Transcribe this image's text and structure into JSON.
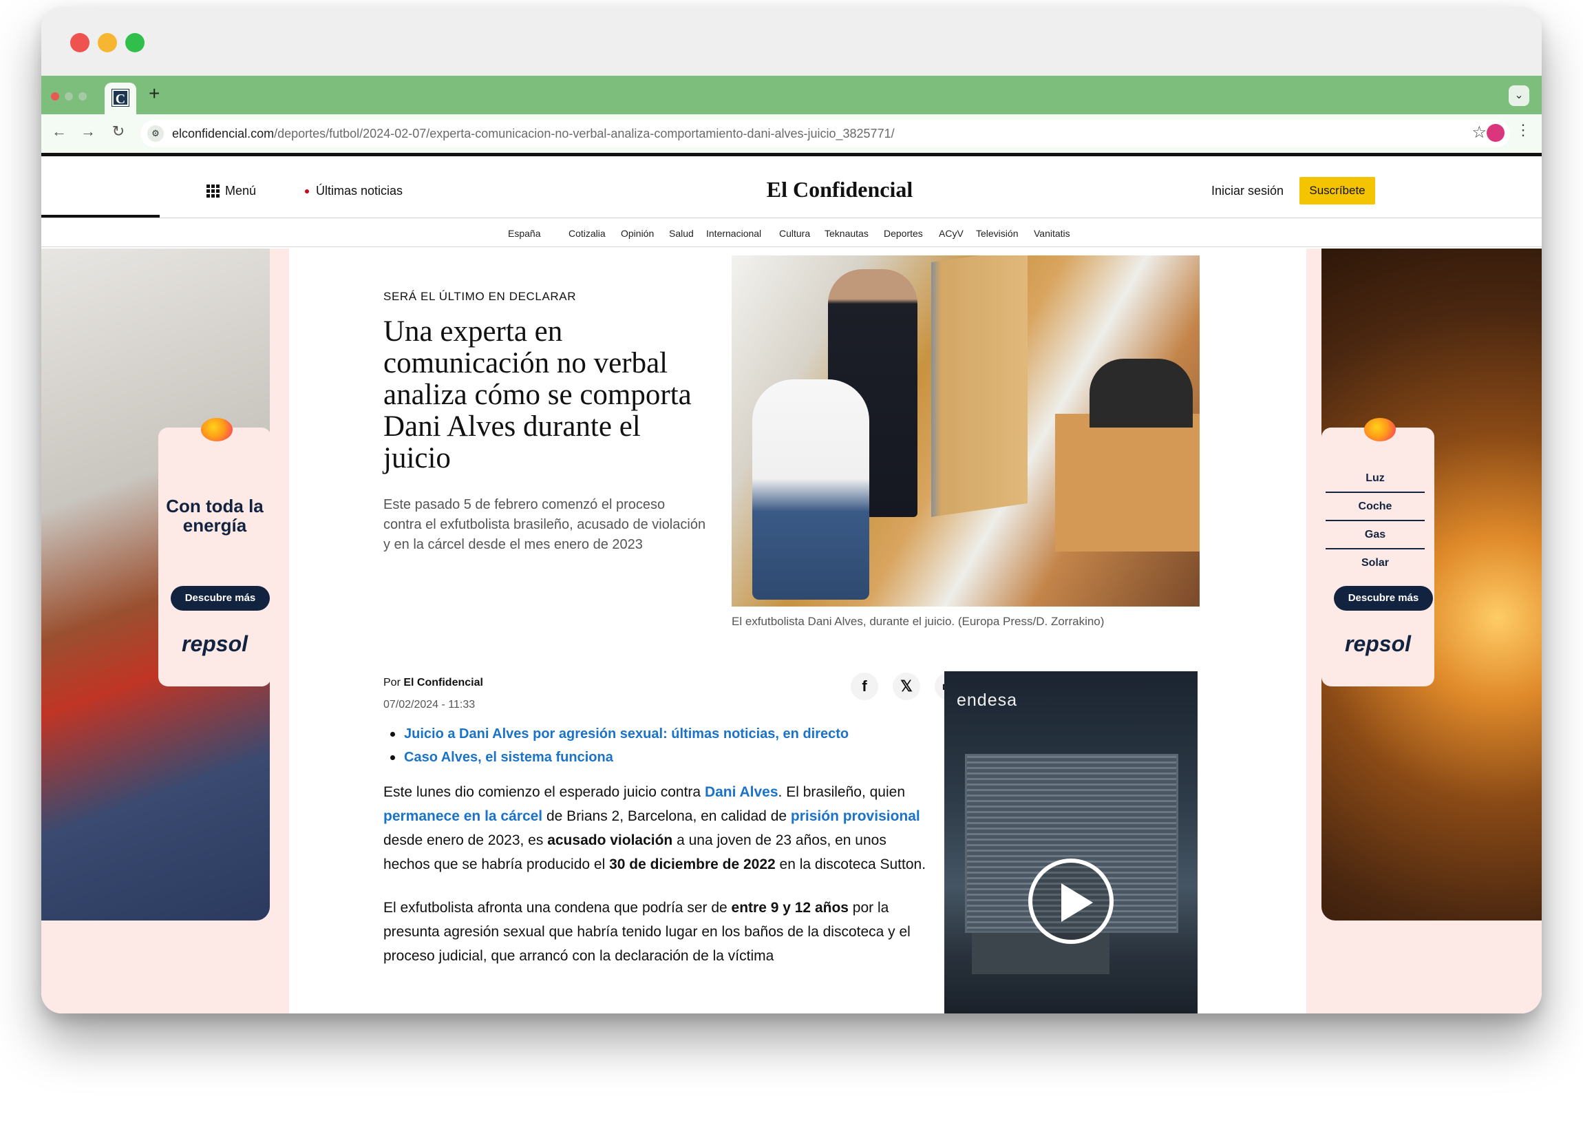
{
  "browser": {
    "new_tab": "+",
    "url_domain": "elconfidencial.com",
    "url_path": "/deportes/futbol/2024-02-07/experta-comunicacion-no-verbal-analiza-comportamiento-dani-alves-juicio_3825771/",
    "favicon_letter": "C"
  },
  "header": {
    "menu_label": "Menú",
    "latest_label": "Últimas noticias",
    "logo": "El Confidencial",
    "login_label": "Iniciar sesión",
    "subscribe_label": "Suscríbete"
  },
  "sections": [
    "España",
    "Cotizalia",
    "Opinión",
    "Salud",
    "Internacional",
    "Cultura",
    "Teknautas",
    "Deportes",
    "ACyV",
    "Televisión",
    "Vanitatis"
  ],
  "ad_left": {
    "headline": "Con toda la energía",
    "button": "Descubre más",
    "brand": "repsol"
  },
  "ad_right": {
    "items": [
      "Luz",
      "Coche",
      "Gas",
      "Solar"
    ],
    "button": "Descubre más",
    "brand": "repsol"
  },
  "article": {
    "kicker": "SERÁ EL ÚLTIMO EN DECLARAR",
    "headline": "Una experta en comunicación no verbal analiza cómo se comporta Dani Alves durante el juicio",
    "dek": "Este pasado 5 de febrero comenzó el proceso contra el exfutbolista brasileño, acusado de violación y en la cárcel desde el mes enero de 2023",
    "caption": "El exfutbolista Dani Alves, durante el juicio. (Europa Press/D. Zorrakino)",
    "by_prefix": "Por",
    "author": "El Confidencial",
    "date": "07/02/2024 - 11:33",
    "related": [
      "Juicio a Dani Alves por agresión sexual: últimas noticias, en directo",
      "Caso Alves, el sistema funciona"
    ],
    "p1": {
      "t1": "Este lunes dio comienzo el esperado juicio contra ",
      "l1": "Dani Alves",
      "t2": ". El brasileño, quien ",
      "l2": "permanece en la cárcel",
      "t3": " de Brians 2, Barcelona, en calidad de ",
      "l3": "prisión provisional",
      "t4": " desde enero de 2023, es ",
      "b1": "acusado violación",
      "t5": " a una joven de 23 años, en unos hechos que se habría producido el ",
      "b2": "30 de diciembre de 2022",
      "t6": " en la discoteca Sutton."
    },
    "p2": {
      "t1": "El exfutbolista afronta una condena que podría ser de ",
      "b1": "entre 9 y 12 años",
      "t2": " por la presunta agresión sexual que habría tenido lugar en los baños de la discoteca y el proceso judicial, que arrancó con la declaración de la víctima"
    }
  },
  "video_ad": {
    "brand": "endesa"
  },
  "colors": {
    "tab_strip": "#7dbe7d",
    "link": "#1a73c9",
    "subscribe": "#f5c400",
    "ad_navy": "#12233f",
    "ad_bg": "#fde9e6"
  }
}
